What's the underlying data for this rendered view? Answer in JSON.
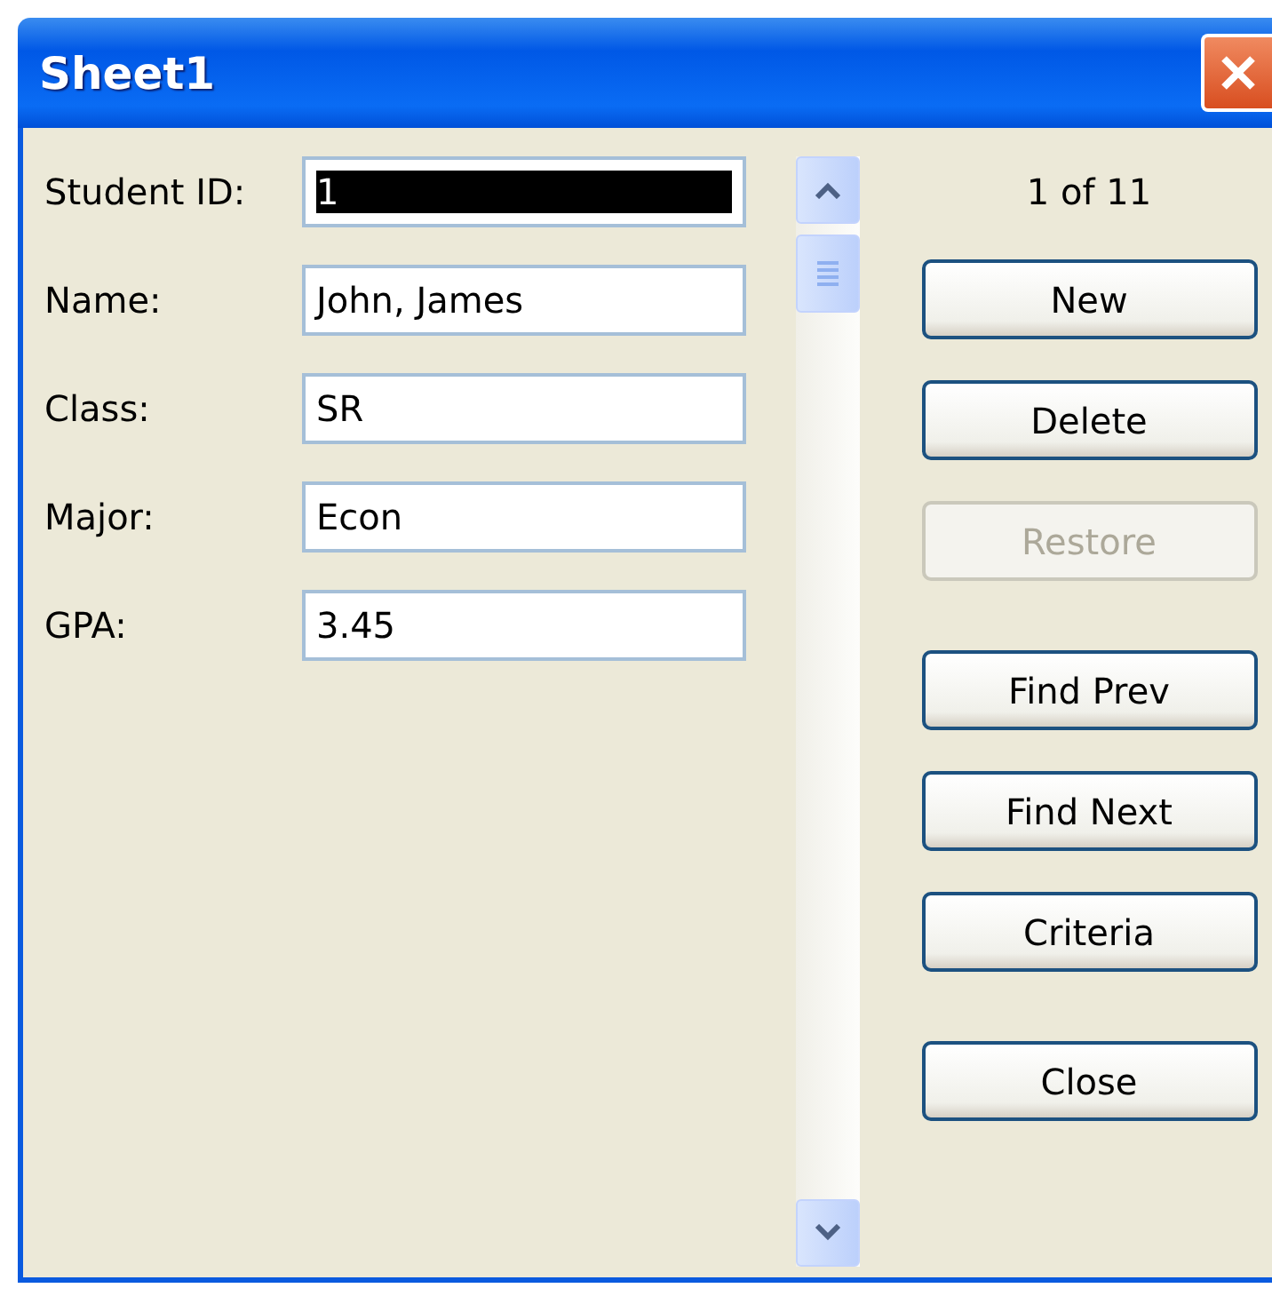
{
  "window": {
    "title": "Sheet1"
  },
  "fields": [
    {
      "label": "Student ID:",
      "value": "1",
      "selected": true
    },
    {
      "label": "Name:",
      "value": "John, James",
      "selected": false
    },
    {
      "label": "Class:",
      "value": "SR",
      "selected": false
    },
    {
      "label": "Major:",
      "value": "Econ",
      "selected": false
    },
    {
      "label": "GPA:",
      "value": "3.45",
      "selected": false
    }
  ],
  "record_counter": "1 of 11",
  "button_groups": [
    [
      {
        "label": "New",
        "disabled": false
      },
      {
        "label": "Delete",
        "disabled": false
      },
      {
        "label": "Restore",
        "disabled": true
      }
    ],
    [
      {
        "label": "Find Prev",
        "disabled": false
      },
      {
        "label": "Find Next",
        "disabled": false
      },
      {
        "label": "Criteria",
        "disabled": false
      }
    ],
    [
      {
        "label": "Close",
        "disabled": false
      }
    ]
  ]
}
